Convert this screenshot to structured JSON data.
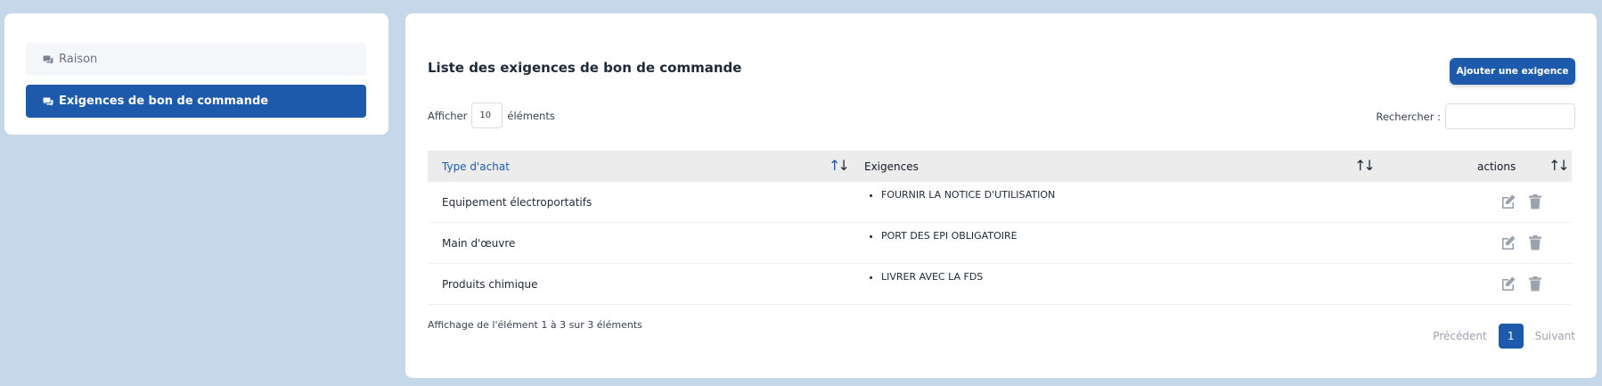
{
  "sidebar": {
    "items": [
      {
        "label": "Raison",
        "icon": "comments-icon",
        "active": false
      },
      {
        "label": "Exigences de bon de commande",
        "icon": "comments-icon",
        "active": true
      }
    ]
  },
  "main": {
    "title": "Liste des exigences de bon de commande",
    "add_button_label": "Ajouter une exigence",
    "length": {
      "prefix": "Afficher",
      "value": "10",
      "suffix": "éléments"
    },
    "search": {
      "label": "Rechercher :",
      "value": ""
    },
    "table": {
      "columns": [
        "Type d'achat",
        "Exigences",
        "actions"
      ],
      "rows": [
        {
          "type": "Equipement électroportatifs",
          "exigence": "FOURNIR LA NOTICE D'UTILISATION"
        },
        {
          "type": "Main d'œuvre",
          "exigence": "PORT DES EPI OBLIGATOIRE"
        },
        {
          "type": "Produits chimique",
          "exigence": "LIVRER AVEC LA FDS"
        }
      ]
    },
    "info": "Affichage de l'élément 1 à 3 sur 3 éléments",
    "pagination": {
      "previous": "Précédent",
      "current": "1",
      "next": "Suivant"
    }
  },
  "colors": {
    "background": "#c5d8ea",
    "accent": "#1e5aab",
    "table_header": "#ececec",
    "icon_gray": "#9ca3af"
  }
}
